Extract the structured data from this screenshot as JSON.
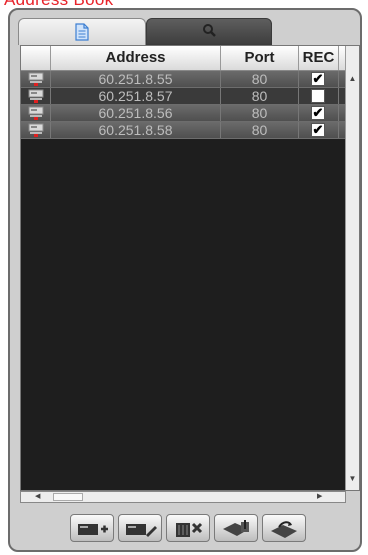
{
  "title": "Address Book",
  "tabs": [
    {
      "name": "address-list",
      "icon": "document-icon"
    },
    {
      "name": "search",
      "icon": "magnifier-icon"
    }
  ],
  "columns": {
    "address": "Address",
    "port": "Port",
    "rec": "REC"
  },
  "rows": [
    {
      "icon": "device-icon",
      "address": "60.251.8.55",
      "port": "80",
      "rec": true
    },
    {
      "icon": "device-icon",
      "address": "60.251.8.57",
      "port": "80",
      "rec": false
    },
    {
      "icon": "device-icon",
      "address": "60.251.8.56",
      "port": "80",
      "rec": true
    },
    {
      "icon": "device-icon",
      "address": "60.251.8.58",
      "port": "80",
      "rec": true
    }
  ],
  "toolbar": [
    {
      "name": "add",
      "icon": "add-device-icon"
    },
    {
      "name": "edit",
      "icon": "edit-device-icon"
    },
    {
      "name": "delete",
      "icon": "delete-device-icon"
    },
    {
      "name": "import",
      "icon": "import-icon"
    },
    {
      "name": "export",
      "icon": "export-icon"
    }
  ],
  "colors": {
    "title": "#e8232a",
    "list_bg": "#1e1e1e",
    "panel": "#cfcfcf"
  }
}
